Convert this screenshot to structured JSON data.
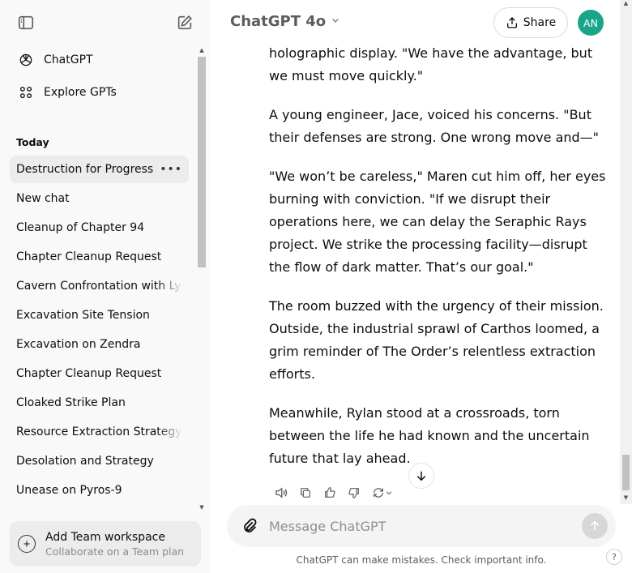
{
  "sidebar": {
    "nav": [
      {
        "label": "ChatGPT",
        "icon": "chatgpt-logo-icon"
      },
      {
        "label": "Explore GPTs",
        "icon": "grid-icon"
      }
    ],
    "section_title": "Today",
    "chats": [
      "Destruction for Progress",
      "New chat",
      "Cleanup of Chapter 94",
      "Chapter Cleanup Request",
      "Cavern Confrontation with Ly",
      "Excavation Site Tension",
      "Excavation on Zendra",
      "Chapter Cleanup Request",
      "Cloaked Strike Plan",
      "Resource Extraction Strategy",
      "Desolation and Strategy",
      "Unease on Pyros-9"
    ],
    "active_chat_index": 0,
    "team": {
      "title": "Add Team workspace",
      "subtitle": "Collaborate on a Team plan"
    }
  },
  "header": {
    "model": "ChatGPT 4o",
    "share_label": "Share",
    "avatar_initials": "AN",
    "avatar_color": "#19a58a"
  },
  "messages": [
    "holographic display. \"We have the advantage, but we must move quickly.\"",
    "A young engineer, Jace, voiced his concerns. \"But their defenses are strong. One wrong move and—\"",
    "\"We won’t be careless,\" Maren cut him off, her eyes burning with conviction. \"If we disrupt their operations here, we can delay the Seraphic Rays project. We strike the processing facility—disrupt the flow of dark matter. That’s our goal.\"",
    "The room buzzed with the urgency of their mission. Outside, the industrial sprawl of Carthos loomed, a grim reminder of The Order’s relentless extraction efforts.",
    "Meanwhile, Rylan stood at a crossroads, torn between the life he had known and the uncertain future that lay ahead."
  ],
  "composer": {
    "placeholder": "Message ChatGPT"
  },
  "disclaimer": "ChatGPT can make mistakes. Check important info.",
  "help_label": "?"
}
